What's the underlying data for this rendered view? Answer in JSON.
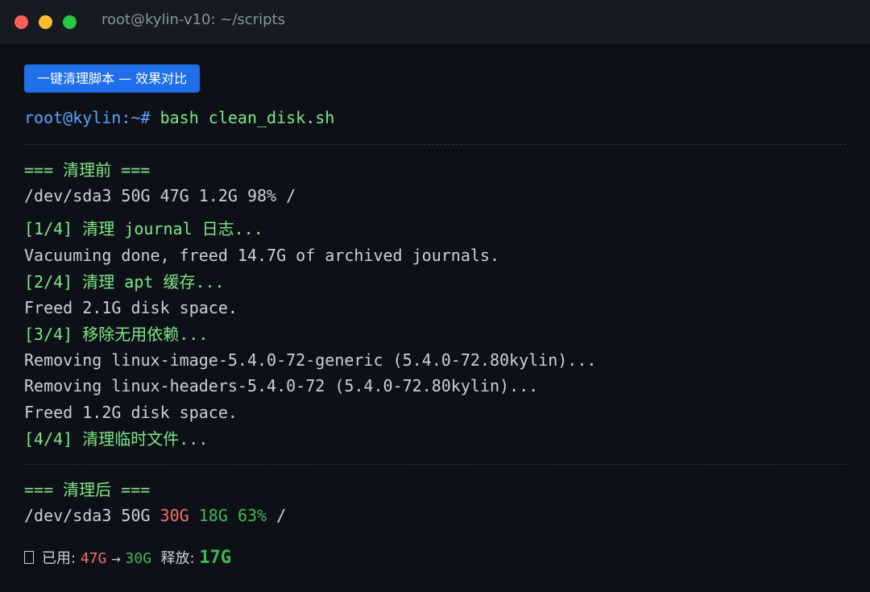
{
  "window": {
    "title": "root@kylin-v10: ~/scripts",
    "badge": "一键清理脚本 — 效果对比"
  },
  "prompt": {
    "user_host": "root@kylin",
    "path_symbol": ":~#",
    "command": " bash clean_disk.sh"
  },
  "before": {
    "header": "=== 清理前 ===",
    "df_line": "/dev/sda3 50G 47G 1.2G 98% /"
  },
  "steps": [
    {
      "label": "[1/4] 清理 journal 日志...",
      "output": [
        "Vacuuming done, freed 14.7G of archived journals."
      ]
    },
    {
      "label": "[2/4] 清理 apt 缓存...",
      "output": [
        "Freed 2.1G disk space."
      ]
    },
    {
      "label": "[3/4] 移除无用依赖...",
      "output": [
        "Removing linux-image-5.4.0-72-generic (5.4.0-72.80kylin)...",
        "Removing linux-headers-5.4.0-72 (5.4.0-72.80kylin)...",
        "Freed 1.2G disk space."
      ]
    },
    {
      "label": "[4/4] 清理临时文件...",
      "output": []
    }
  ],
  "after": {
    "header": "=== 清理后 ===",
    "device": "/dev/sda3",
    "size": "50G",
    "used": "30G",
    "avail": "18G",
    "percent": "63%",
    "mount": "/"
  },
  "summary": {
    "icon": "chart-icon",
    "used_label": "已用:",
    "used_before": "47G",
    "arrow": "→",
    "used_after": "30G",
    "freed_label": "释放:",
    "freed_value": "17G"
  },
  "colors": {
    "accent_blue": "#58a6ff",
    "green": "#7ee787",
    "red": "#f47067",
    "badge": "#1f6feb"
  }
}
